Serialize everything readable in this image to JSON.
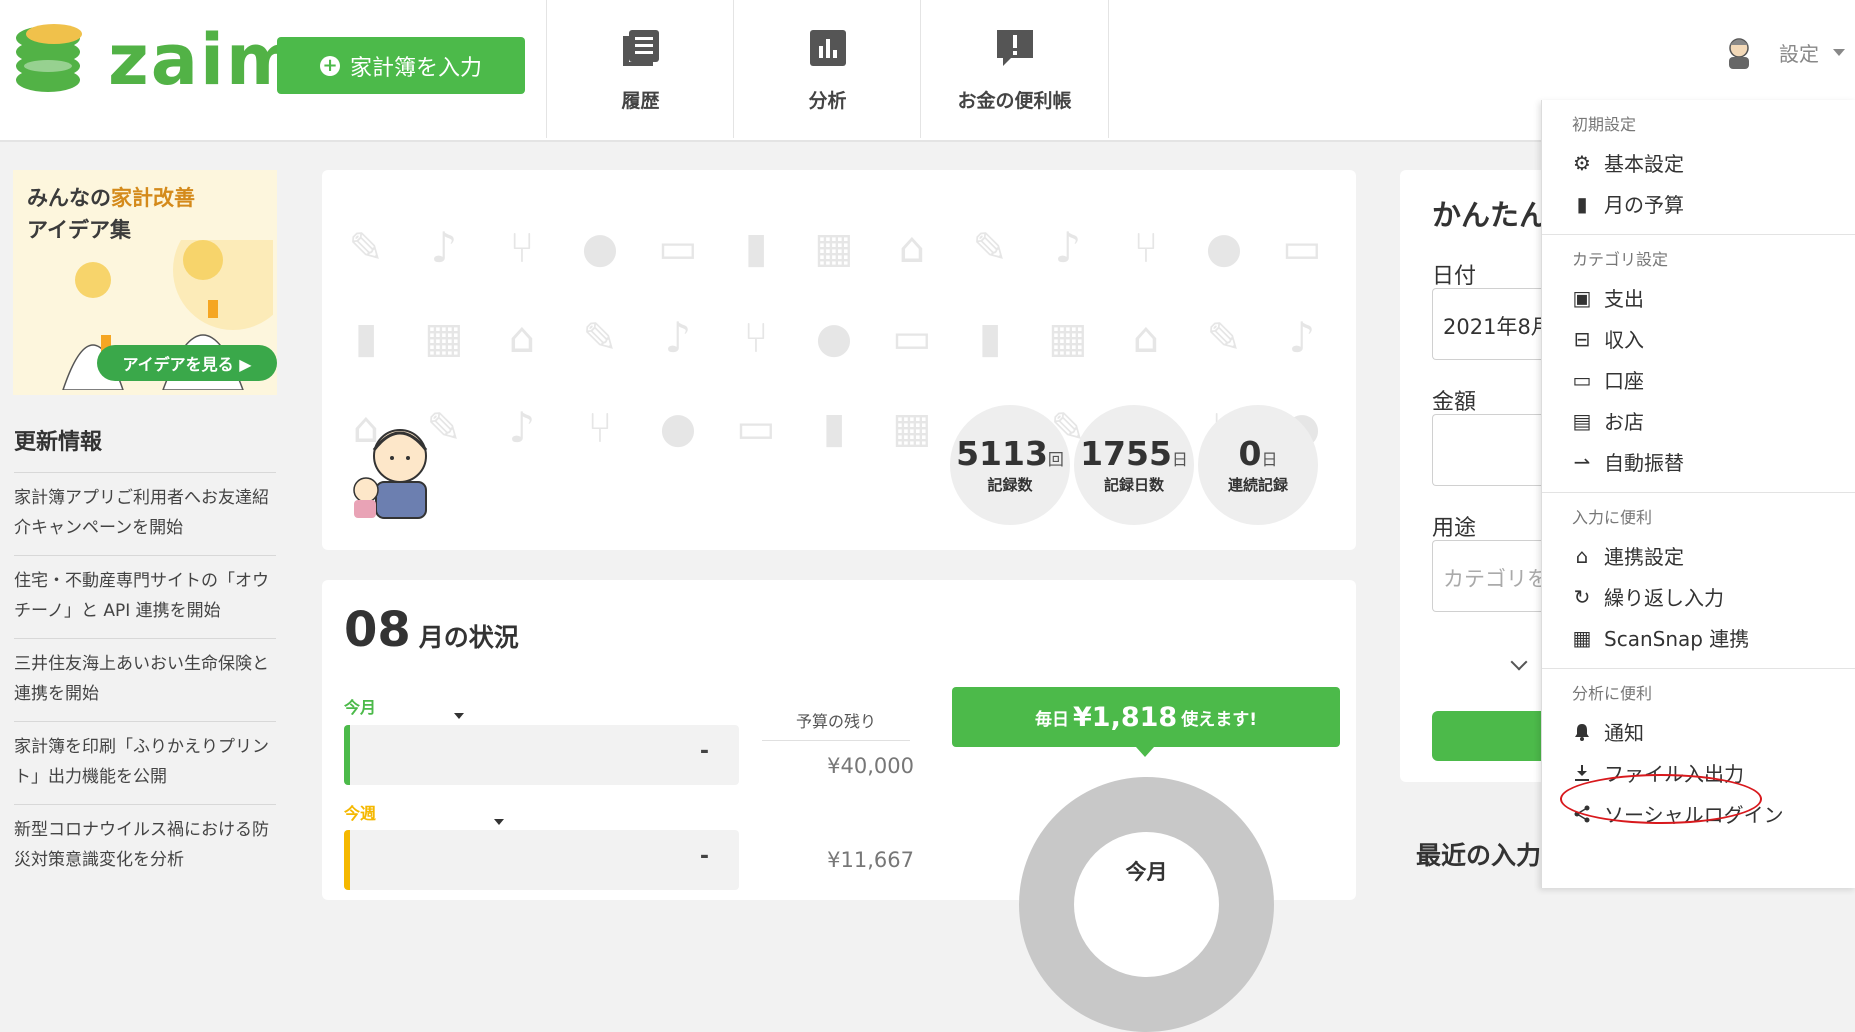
{
  "header": {
    "logo_text": "zaim",
    "input_button": "家計簿を入力",
    "nav": [
      {
        "label": "履歴",
        "icon": "history-icon"
      },
      {
        "label": "分析",
        "icon": "analysis-icon"
      },
      {
        "label": "お金の便利帳",
        "icon": "money-notebook-icon"
      }
    ],
    "settings_label": "設定"
  },
  "sidebar": {
    "banner": {
      "title_line1_prefix": "みんなの",
      "title_line1_highlight": "家計改善",
      "title_line2": "アイデア集",
      "button": "アイデアを見る ▶"
    },
    "news_title": "更新情報",
    "news": [
      "家計簿アプリご利用者へお友達紹介キャンペーンを開始",
      "住宅・不動産専門サイトの「オウチーノ」と API 連携を開始",
      "三井住友海上あいおい生命保険と連携を開始",
      "家計簿を印刷「ふりかえりプリント」出力機能を公開",
      "新型コロナウイルス禍における防災対策意識変化を分析"
    ]
  },
  "stats": [
    {
      "value": "5113",
      "unit": "回",
      "label": "記録数"
    },
    {
      "value": "1755",
      "unit": "日",
      "label": "記録日数"
    },
    {
      "value": "0",
      "unit": "日",
      "label": "連続記録"
    }
  ],
  "month": {
    "number": "08",
    "suffix": "月の状況",
    "this_month_label": "今月",
    "this_week_label": "今週",
    "this_month_value": "-",
    "this_week_value": "-",
    "remaining_header": "予算の残り",
    "remaining_month": "¥40,000",
    "remaining_week": "¥11,667",
    "daily_prefix": "毎日",
    "daily_amount": "¥1,818",
    "daily_suffix": "使えます!",
    "donut_label": "今月",
    "colors": {
      "month": "#4cba4a",
      "week": "#f5b800"
    }
  },
  "quick_input": {
    "title": "かんたん",
    "date_label": "日付",
    "date_value": "2021年8月",
    "amount_label": "金額",
    "purpose_label": "用途",
    "category_placeholder": "カテゴリを"
  },
  "recent_title": "最近の入力",
  "dropdown": {
    "sections": [
      {
        "title": "初期設定",
        "items": [
          {
            "label": "基本設定",
            "icon": "gear-icon",
            "glyph": "⚙"
          },
          {
            "label": "月の予算",
            "icon": "book-icon",
            "glyph": "▮"
          }
        ]
      },
      {
        "title": "カテゴリ設定",
        "items": [
          {
            "label": "支出",
            "icon": "wallet-icon",
            "glyph": "▣"
          },
          {
            "label": "収入",
            "icon": "income-icon",
            "glyph": "⊟"
          },
          {
            "label": "口座",
            "icon": "card-icon",
            "glyph": "▭"
          },
          {
            "label": "お店",
            "icon": "store-icon",
            "glyph": "▤"
          },
          {
            "label": "自動振替",
            "icon": "transfer-icon",
            "glyph": "⇀"
          }
        ]
      },
      {
        "title": "入力に便利",
        "items": [
          {
            "label": "連携設定",
            "icon": "bank-icon",
            "glyph": "⌂"
          },
          {
            "label": "繰り返し入力",
            "icon": "repeat-icon",
            "glyph": "↻"
          },
          {
            "label": "ScanSnap 連携",
            "icon": "printer-icon",
            "glyph": "▦"
          }
        ]
      },
      {
        "title": "分析に便利",
        "items": [
          {
            "label": "通知",
            "icon": "bell-icon",
            "glyph": "🔔"
          },
          {
            "label": "ファイル入出力",
            "icon": "download-icon",
            "glyph": "⤓"
          },
          {
            "label": "ソーシャルログイン",
            "icon": "share-icon",
            "glyph": "⋖"
          }
        ]
      }
    ]
  }
}
